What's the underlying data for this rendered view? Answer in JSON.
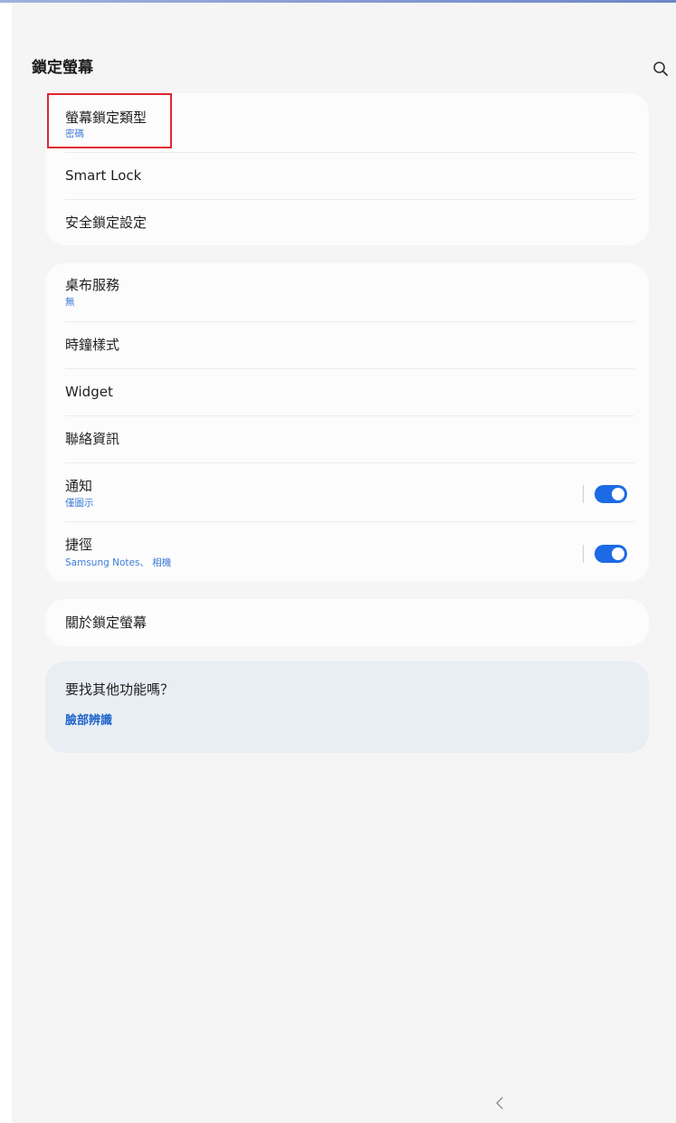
{
  "header": {
    "title": "鎖定螢幕",
    "search_icon": "search-icon"
  },
  "group1": {
    "items": [
      {
        "label": "螢幕鎖定類型",
        "sub": "密碼"
      },
      {
        "label": "Smart Lock"
      },
      {
        "label": "安全鎖定設定"
      }
    ]
  },
  "group2": {
    "items": [
      {
        "label": "桌布服務",
        "sub": "無"
      },
      {
        "label": "時鐘樣式"
      },
      {
        "label": "Widget"
      },
      {
        "label": "聯絡資訊"
      },
      {
        "label": "通知",
        "sub": "僅圖示",
        "toggle": true
      },
      {
        "label": "捷徑",
        "sub": "Samsung Notes、 相機",
        "toggle": true
      }
    ]
  },
  "group3": {
    "items": [
      {
        "label": "關於鎖定螢幕"
      }
    ]
  },
  "suggestion": {
    "title": "要找其他功能嗎？",
    "link": "臉部辨識"
  },
  "navbar": {
    "back_icon": "chevron-left-icon"
  },
  "colors": {
    "accent": "#1d6ae5",
    "subtext": "#3e7cd6",
    "highlight_box": "#e0262f",
    "card": "#fcfcfc",
    "background": "#f5f5f5",
    "suggestion_bg": "#e8eef4"
  }
}
